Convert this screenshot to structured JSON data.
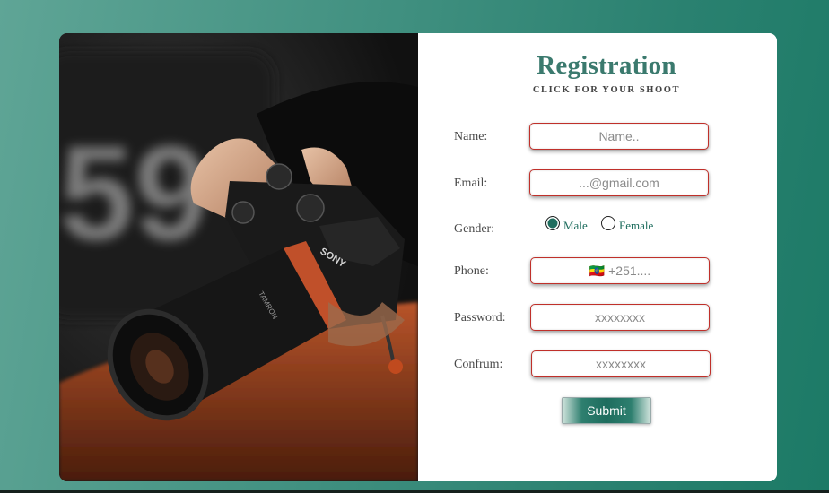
{
  "form": {
    "title": "Registration",
    "subtitle": "CLICK FOR YOUR SHOOT",
    "name_label": "Name:",
    "name_placeholder": "Name..",
    "email_label": "Email:",
    "email_placeholder": "...@gmail.com",
    "gender_label": "Gender:",
    "gender_options": [
      {
        "label": "Male",
        "checked": true
      },
      {
        "label": "Female",
        "checked": false
      }
    ],
    "phone_label": "Phone:",
    "phone_placeholder": "🇪🇹 +251....",
    "password_label": "Password:",
    "password_placeholder": "xxxxxxxx",
    "confirm_label": "Confrum:",
    "confirm_placeholder": "xxxxxxxx",
    "submit_label": "Submit"
  },
  "photo": {
    "background_text": "59",
    "brand_text": "SONY",
    "lens_text": "TAMRON"
  },
  "colors": {
    "accent": "#1e6d5e",
    "title": "#3b7a6e",
    "field_border": "#c0302a"
  }
}
